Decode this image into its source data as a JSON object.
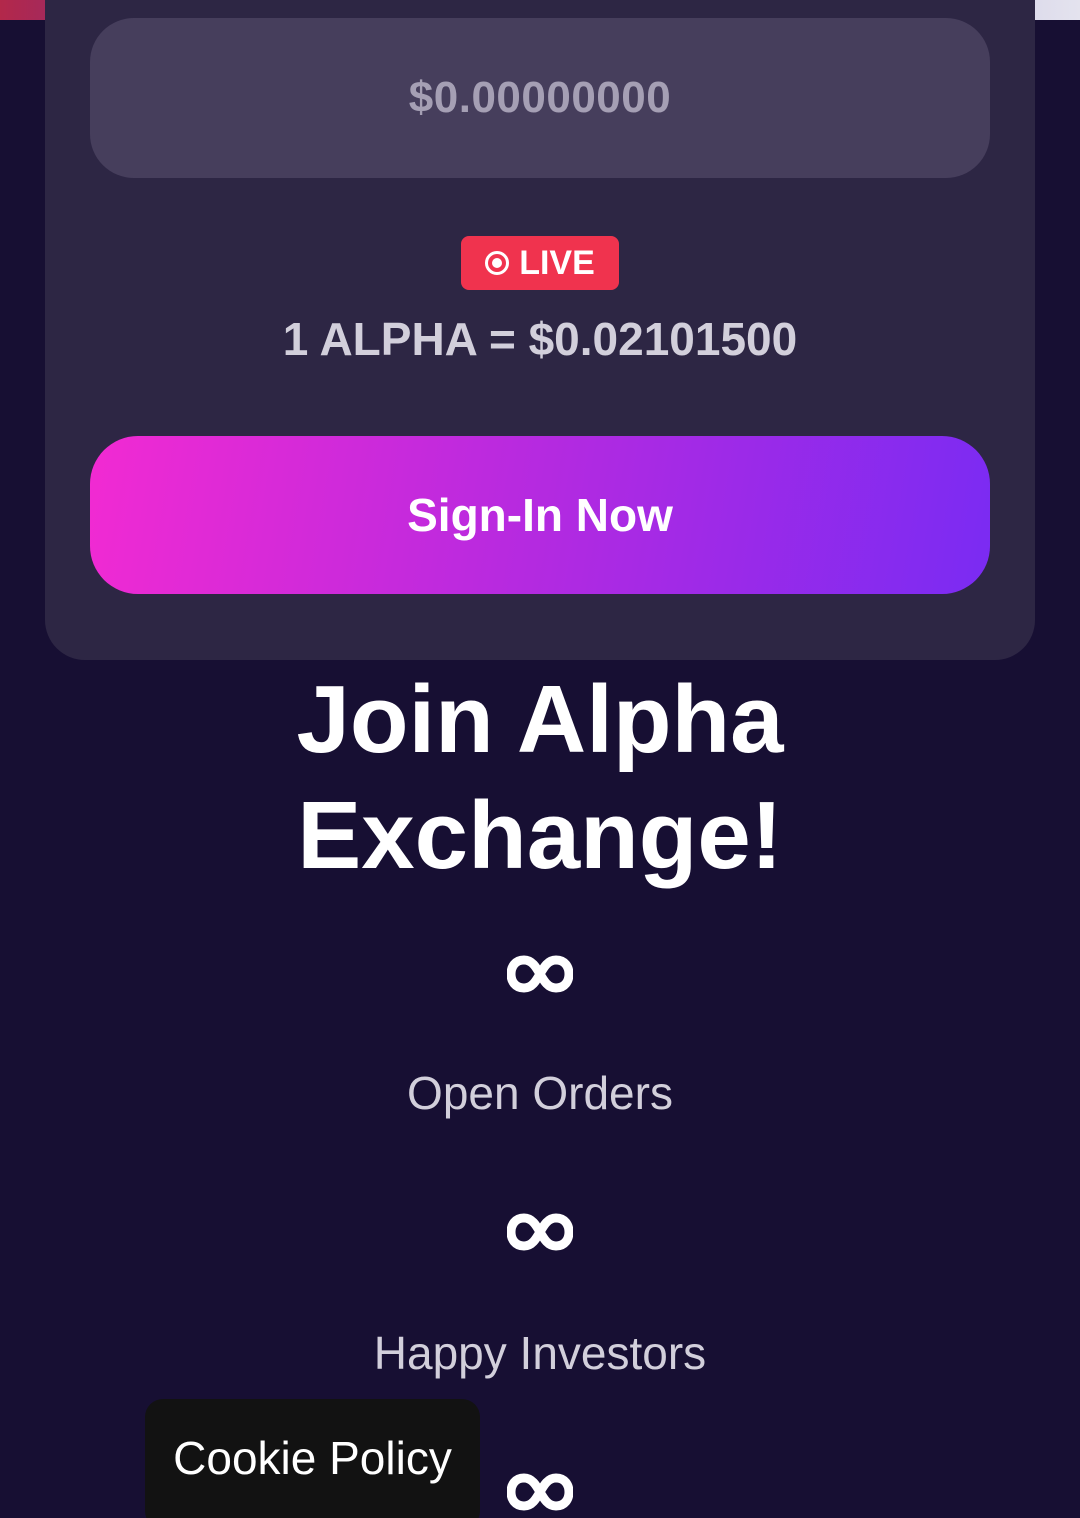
{
  "progress": {
    "fraction": 1.0
  },
  "exchange_card": {
    "amount_value": "$0.00000000",
    "live_label": "LIVE",
    "rate_text": "1 ALPHA = $0.02101500",
    "signin_label": "Sign-In Now"
  },
  "hero": {
    "title_line1": "Join Alpha",
    "title_line2": "Exchange!"
  },
  "stats": [
    {
      "icon": "infinity-icon",
      "label": "Open Orders"
    },
    {
      "icon": "infinity-icon",
      "label": "Happy Investors"
    },
    {
      "icon": "infinity-icon",
      "label": ""
    }
  ],
  "cookie": {
    "label": "Cookie Policy"
  },
  "colors": {
    "background": "#170f33",
    "card": "#2d2644",
    "live_badge": "#f0334e",
    "button_gradient_start": "#f22ad2",
    "button_gradient_end": "#7a2bf3"
  }
}
